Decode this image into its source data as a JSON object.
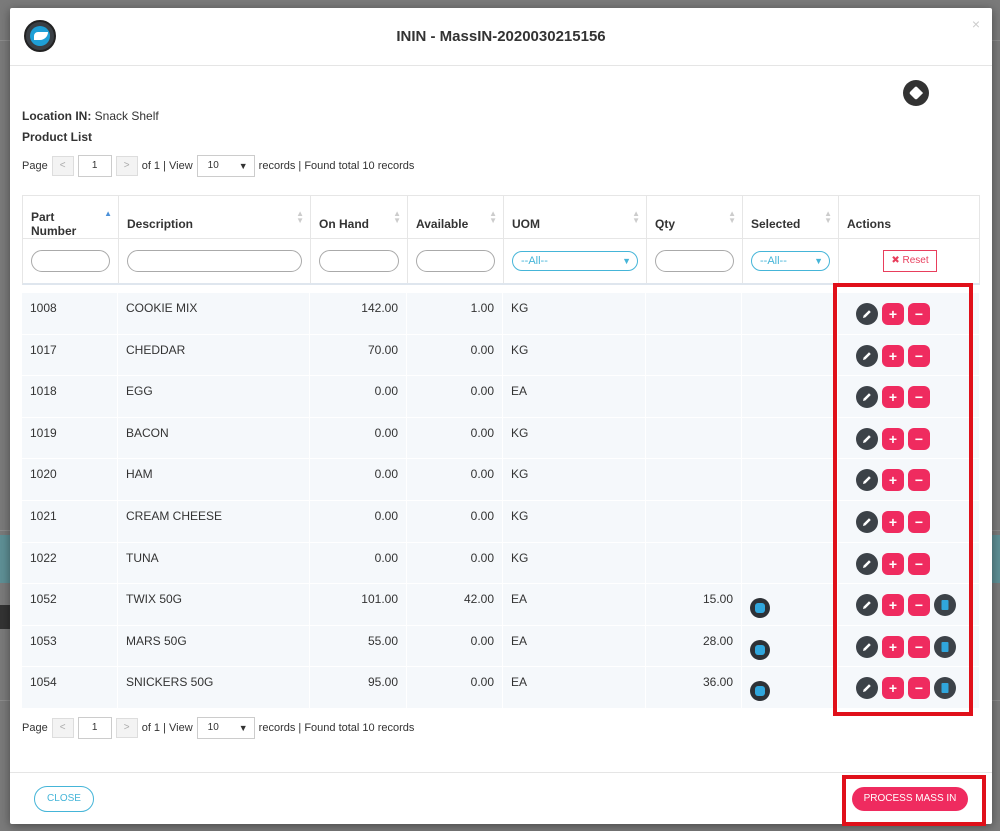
{
  "modal": {
    "title": "ININ - MassIN-2020030215156",
    "close_glyph": "×"
  },
  "location": {
    "label": "Location IN:",
    "value": "Snack Shelf"
  },
  "product_list_label": "Product List",
  "pager": {
    "page_label": "Page",
    "prev_glyph": "<",
    "next_glyph": ">",
    "current_page": "1",
    "of_text": "of 1 | View",
    "per_page": "10",
    "records_text": "records | Found total 10 records"
  },
  "table": {
    "headers": [
      "Part Number",
      "Description",
      "On Hand",
      "Available",
      "UOM",
      "Qty",
      "Selected",
      "Actions"
    ],
    "filter_uom": "--All--",
    "filter_selected": "--All--",
    "reset_label": "✖ Reset",
    "rows": [
      {
        "part": "1008",
        "desc": "COOKIE MIX",
        "onhand": "142.00",
        "avail": "1.00",
        "uom": "KG",
        "qty": "",
        "selected": false
      },
      {
        "part": "1017",
        "desc": "CHEDDAR",
        "onhand": "70.00",
        "avail": "0.00",
        "uom": "KG",
        "qty": "",
        "selected": false
      },
      {
        "part": "1018",
        "desc": "EGG",
        "onhand": "0.00",
        "avail": "0.00",
        "uom": "EA",
        "qty": "",
        "selected": false
      },
      {
        "part": "1019",
        "desc": "BACON",
        "onhand": "0.00",
        "avail": "0.00",
        "uom": "KG",
        "qty": "",
        "selected": false
      },
      {
        "part": "1020",
        "desc": "HAM",
        "onhand": "0.00",
        "avail": "0.00",
        "uom": "KG",
        "qty": "",
        "selected": false
      },
      {
        "part": "1021",
        "desc": "CREAM CHEESE",
        "onhand": "0.00",
        "avail": "0.00",
        "uom": "KG",
        "qty": "",
        "selected": false
      },
      {
        "part": "1022",
        "desc": "TUNA",
        "onhand": "0.00",
        "avail": "0.00",
        "uom": "KG",
        "qty": "",
        "selected": false
      },
      {
        "part": "1052",
        "desc": "TWIX 50G",
        "onhand": "101.00",
        "avail": "42.00",
        "uom": "EA",
        "qty": "15.00",
        "selected": true
      },
      {
        "part": "1053",
        "desc": "MARS 50G",
        "onhand": "55.00",
        "avail": "0.00",
        "uom": "EA",
        "qty": "28.00",
        "selected": true
      },
      {
        "part": "1054",
        "desc": "SNICKERS 50G",
        "onhand": "95.00",
        "avail": "0.00",
        "uom": "EA",
        "qty": "36.00",
        "selected": true
      }
    ]
  },
  "footer": {
    "close_label": "CLOSE",
    "process_label": "PROCESS MASS IN"
  },
  "icons": {
    "plus": "+",
    "minus": "−"
  },
  "colors": {
    "accent_pink": "#ef2b5f",
    "accent_blue": "#45b5d8",
    "highlight_red": "#e0101a"
  }
}
